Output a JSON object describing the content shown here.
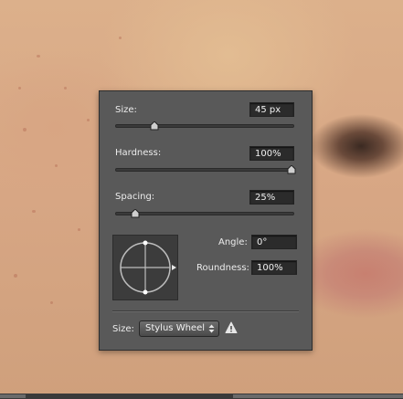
{
  "brush_panel": {
    "size_label": "Size:",
    "size_value": "45 px",
    "size_slider_fraction": 0.22,
    "hardness_label": "Hardness:",
    "hardness_value": "100%",
    "hardness_slider_fraction": 1.0,
    "spacing_label": "Spacing:",
    "spacing_value": "25%",
    "spacing_slider_fraction": 0.11,
    "angle_label": "Angle:",
    "angle_value": "0°",
    "roundness_label": "Roundness:",
    "roundness_value": "100%",
    "size_control_label": "Size:",
    "size_control_value": "Stylus Wheel",
    "warning_icon": "warning-triangle-icon"
  },
  "colors": {
    "panel_bg": "#595959",
    "field_bg": "#2b2b2b",
    "text": "#ececec"
  }
}
